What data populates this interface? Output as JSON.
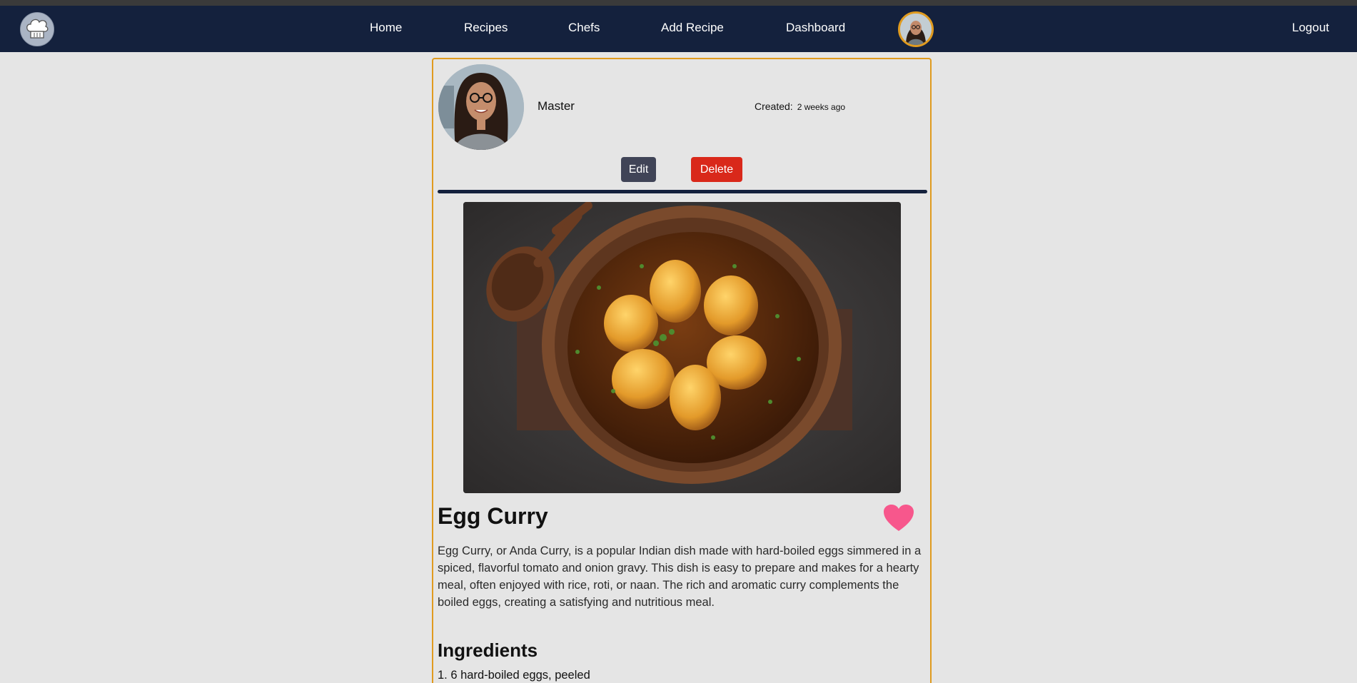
{
  "nav": {
    "logo_icon": "chef-hat-icon",
    "links": [
      "Home",
      "Recipes",
      "Chefs",
      "Add Recipe",
      "Dashboard"
    ],
    "logout": "Logout"
  },
  "recipe": {
    "author": "Master",
    "created_label": "Created:",
    "created_value": "2 weeks ago",
    "edit_label": "Edit",
    "delete_label": "Delete",
    "title": "Egg Curry",
    "description": "Egg Curry, or Anda Curry, is a popular Indian dish made with hard-boiled eggs simmered in a spiced, flavorful tomato and onion gravy. This dish is easy to prepare and makes for a hearty meal, often enjoyed with rice, roti, or naan. The rich and aromatic curry complements the boiled eggs, creating a satisfying and nutritious meal.",
    "ingredients_heading": "Ingredients",
    "ingredients": [
      "1. 6 hard-boiled eggs, peeled"
    ]
  },
  "colors": {
    "navbar": "#14213d",
    "accent": "#e09b1f",
    "delete": "#d9281a",
    "edit": "#404457",
    "heart": "#f7578c"
  }
}
